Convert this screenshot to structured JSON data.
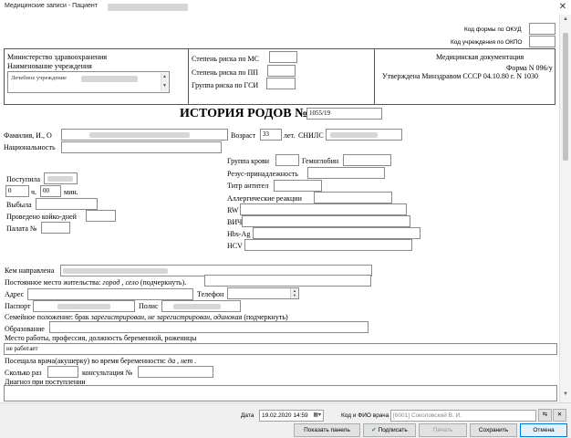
{
  "window": {
    "title": "Медицинские записи - Пациент"
  },
  "header": {
    "okud_label": "Код формы по ОКУД",
    "okpo_label": "Код учреждения по ОКПО",
    "ministry": "Министерство здравоохранения",
    "institution_label": "Наименование учреждения",
    "institution_value": "Лечебное учреждение",
    "risk_ms": "Степень риска по МС",
    "risk_pp": "Степень риска по ПП",
    "risk_gsi": "Группа риска по ГСИ",
    "doc_title": "Медицинская документация",
    "doc_form": "Форма N 096/у",
    "doc_approved": "Утверждена Минздравом СССР 04.10.80 г. N 1030"
  },
  "history": {
    "title": "ИСТОРИЯ РОДОВ №",
    "number": "1055/19"
  },
  "patient": {
    "fio_label": "Фамилия, И., О",
    "age_label": "Возраст",
    "age_value": "33",
    "age_unit": "лет.",
    "snils_label": "СНИЛС",
    "nationality_label": "Национальность"
  },
  "blood": {
    "group_label": "Группа крови",
    "hemoglobin_label": "Гемоглобин",
    "rhesus_label": "Резус-принадлежность",
    "titer_label": "Титр антител",
    "allergy_label": "Аллергические реакции",
    "rw_label": "RW",
    "hiv_label": "ВИЧ",
    "hbs_label": "Hbs-Ag",
    "hcv_label": "HCV"
  },
  "admission": {
    "admitted_label": "Поступила",
    "hours_value": "0",
    "hours_unit": "ч.",
    "minutes_value": "00",
    "minutes_unit": "мин.",
    "discharged_label": "Выбыла",
    "bed_days_label": "Проведено койко-дней",
    "ward_label": "Палата №"
  },
  "details": {
    "referred_label": "Кем направлена",
    "residence_label": "Постоянное место жительства:",
    "residence_options": "город , село",
    "residence_note": "(подчеркнуть).",
    "address_label": "Адрес",
    "phone_label": "Телефон",
    "passport_label": "Паспорт",
    "policy_label": "Полис",
    "marital_label": "Семейное положение: брак",
    "marital_registered": "зарегистрирован",
    "marital_not_registered": ", не зарегистрирован",
    "marital_single": ", одинокая",
    "marital_note": "(подчеркнуть)",
    "education_label": "Образование",
    "work_label": "Место работы, профессия, должность беременной, роженицы",
    "work_value": "не работает",
    "visited_label": "Посещала врача(акушерку) во время беременности:",
    "visited_options": "да , нет .",
    "times_label": "Сколько раз",
    "consultation_label": "консультация №",
    "diagnosis_label": "Диагноз при поступлении"
  },
  "footer": {
    "date_label": "Дата",
    "date_value": "19.02.2020 14:59",
    "doctor_label": "Код и ФИО врача",
    "doctor_value": "[6001] Соколовский В. И.",
    "show_panel": "Показать панель",
    "sign": "Подписать",
    "print": "Печать",
    "save": "Сохранить",
    "cancel": "Отмена"
  }
}
